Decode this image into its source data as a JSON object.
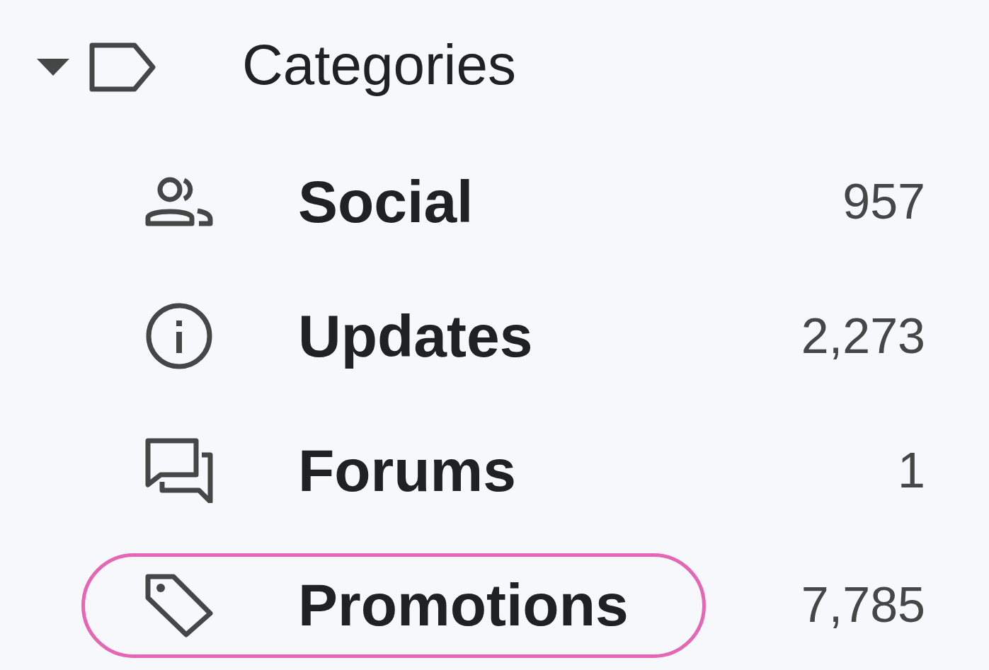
{
  "section": {
    "title": "Categories",
    "expanded": true
  },
  "items": [
    {
      "kind": "social",
      "label": "Social",
      "count": "957",
      "highlighted": false
    },
    {
      "kind": "updates",
      "label": "Updates",
      "count": "2,273",
      "highlighted": false
    },
    {
      "kind": "forums",
      "label": "Forums",
      "count": "1",
      "highlighted": false
    },
    {
      "kind": "promotions",
      "label": "Promotions",
      "count": "7,785",
      "highlighted": true
    }
  ]
}
